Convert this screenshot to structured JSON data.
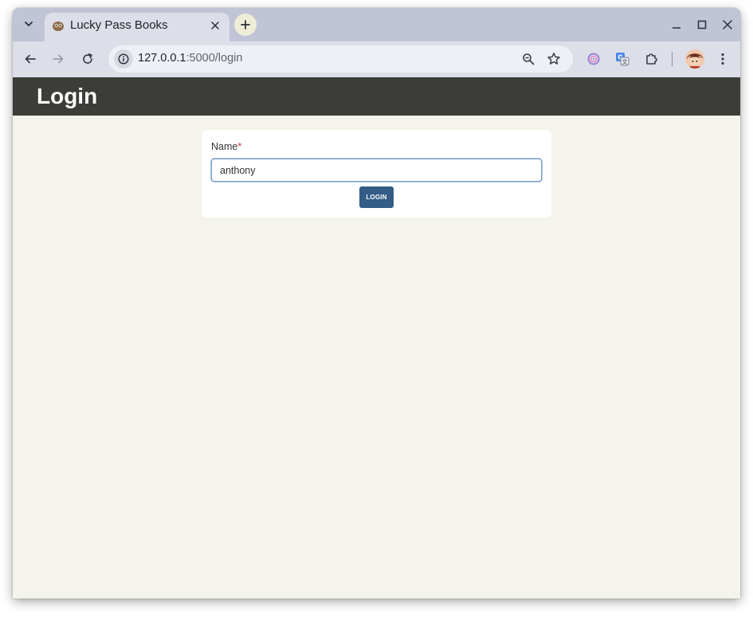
{
  "browser": {
    "tab": {
      "title": "Lucky Pass Books",
      "favicon": "owl-favicon-icon"
    },
    "address_bar": {
      "url_host": "127.0.0.1",
      "url_rest": ":5000/login"
    },
    "colors": {
      "tabstrip": "#c0c4d6",
      "toolbar": "#dcdfe8"
    },
    "icons": [
      "tab-search-icon",
      "tab-close-icon",
      "new-tab-icon",
      "minimize-icon",
      "maximize-icon",
      "close-window-icon",
      "back-icon",
      "forward-icon",
      "reload-icon",
      "site-info-icon",
      "zoom-icon",
      "bookmark-star-icon",
      "ai-extension-icon",
      "translate-extension-icon",
      "extensions-puzzle-icon",
      "profile-avatar",
      "menu-kebab-icon"
    ]
  },
  "page": {
    "header_title": "Login",
    "form": {
      "name_label": "Name",
      "required_marker": "*",
      "name_value": "anthony",
      "submit_label": "Login"
    },
    "colors": {
      "header_bg": "#3c3c38",
      "page_bg": "#f5f4ec",
      "button_bg": "#335c86",
      "required": "#c7342c"
    }
  }
}
